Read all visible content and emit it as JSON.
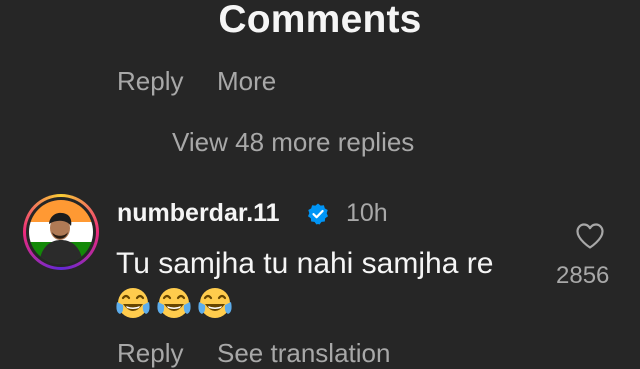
{
  "header": {
    "title": "Comments"
  },
  "previous_comment": {
    "reply_label": "Reply",
    "more_label": "More",
    "view_replies_label": "View 48 more replies"
  },
  "comment": {
    "username": "numberdar.11",
    "verified": true,
    "time": "10h",
    "text": "Tu samjha tu nahi samjha re",
    "emojis": [
      "face-with-tears-of-joy",
      "face-with-tears-of-joy",
      "face-with-tears-of-joy"
    ],
    "like_count": "2856",
    "reply_label": "Reply",
    "see_translation_label": "See translation"
  },
  "colors": {
    "background": "#262626",
    "primary_text": "#f5f5f5",
    "secondary_text": "#a8a8a8",
    "verified_blue": "#0095f6"
  },
  "icons": {
    "verified": "verified-badge-icon",
    "like": "heart-outline-icon",
    "emoji": "face-with-tears-of-joy"
  }
}
